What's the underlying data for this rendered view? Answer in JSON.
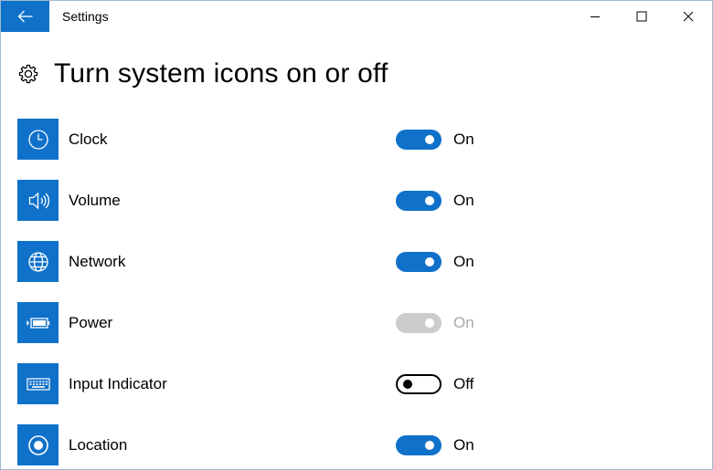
{
  "window": {
    "title": "Settings",
    "accent_color": "#0f71c9",
    "controls": {
      "minimize_icon": "minimize-icon",
      "maximize_icon": "maximize-icon",
      "close_icon": "close-icon"
    }
  },
  "back_button": {
    "icon": "back-arrow-icon"
  },
  "header": {
    "icon": "gear-icon",
    "title": "Turn system icons on or off"
  },
  "rows": [
    {
      "label": "Clock",
      "icon": "clock-icon",
      "state": "On",
      "enabled": true
    },
    {
      "label": "Volume",
      "icon": "volume-icon",
      "state": "On",
      "enabled": true
    },
    {
      "label": "Network",
      "icon": "globe-icon",
      "state": "On",
      "enabled": true
    },
    {
      "label": "Power",
      "icon": "battery-icon",
      "state": "On",
      "enabled": false
    },
    {
      "label": "Input Indicator",
      "icon": "keyboard-icon",
      "state": "Off",
      "enabled": true
    },
    {
      "label": "Location",
      "icon": "location-icon",
      "state": "On",
      "enabled": true
    }
  ]
}
